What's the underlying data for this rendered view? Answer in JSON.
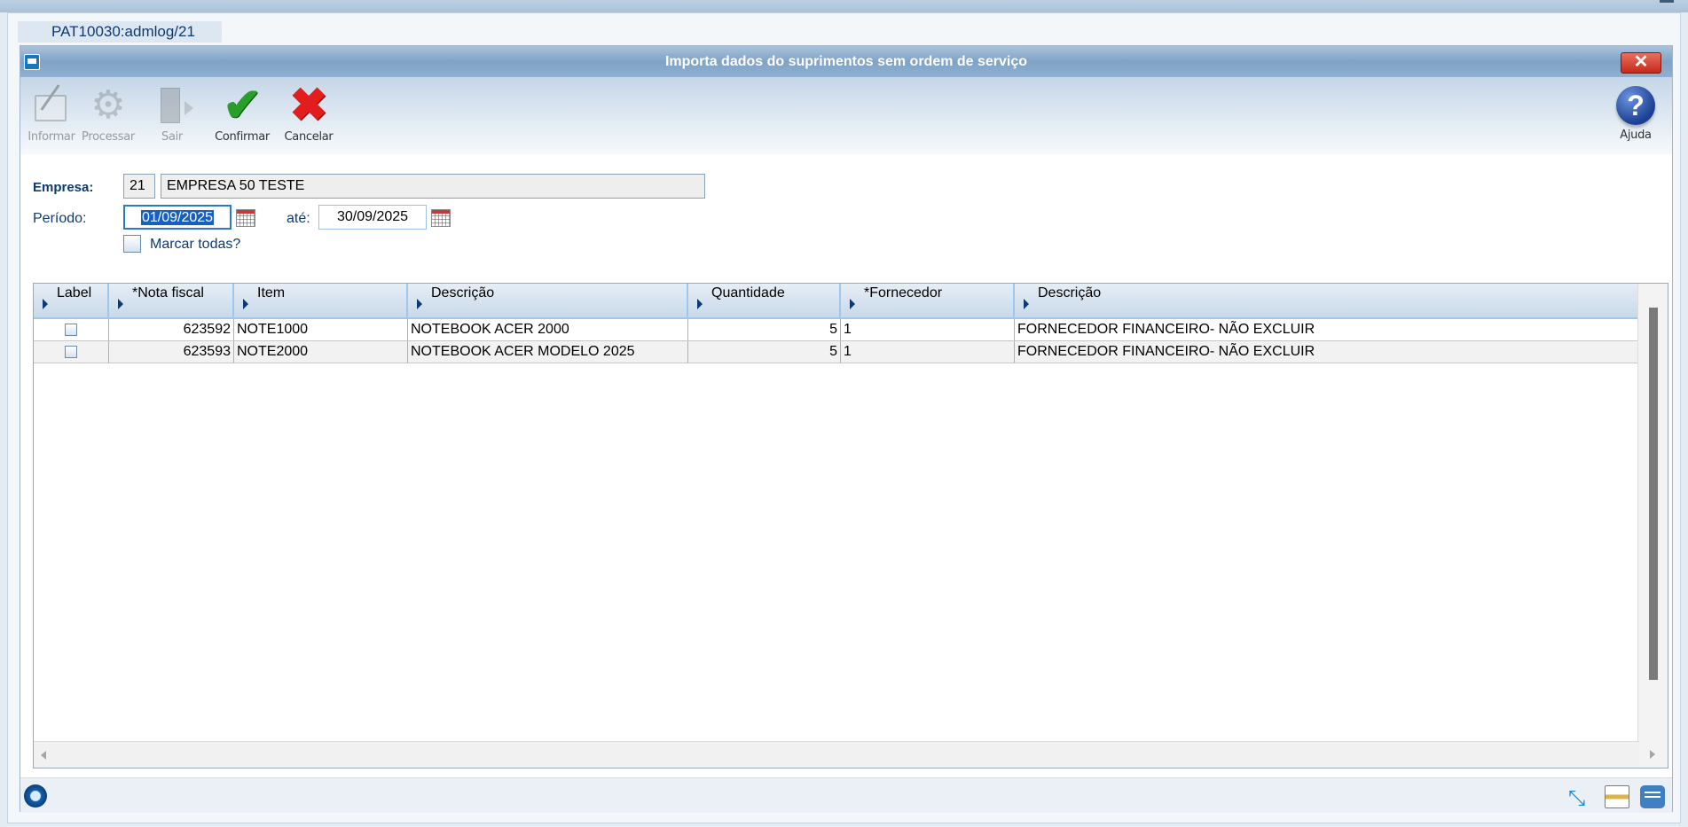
{
  "tab": {
    "label": "PAT10030:admlog/21"
  },
  "window": {
    "title": "Importa dados do suprimentos sem ordem de serviço",
    "close_label": "✕"
  },
  "toolbar": {
    "informar": "Informar",
    "processar": "Processar",
    "sair": "Sair",
    "confirmar": "Confirmar",
    "cancelar": "Cancelar",
    "ajuda": "Ajuda",
    "help_glyph": "?"
  },
  "form": {
    "empresa_label": "Empresa:",
    "empresa_code": "21",
    "empresa_name": "EMPRESA 50 TESTE",
    "periodo_label": "Período:",
    "date_from": "01/09/2025",
    "ate_label": "até:",
    "date_to": "30/09/2025",
    "marcar_label": "Marcar todas?"
  },
  "grid": {
    "columns": [
      "Label",
      "*Nota fiscal",
      "Item",
      "Descrição",
      "Quantidade",
      "*Fornecedor",
      "Descrição"
    ],
    "rows": [
      {
        "checked": false,
        "nota": "623592",
        "item": "NOTE1000",
        "descricao": "NOTEBOOK ACER 2000",
        "quantidade": "5",
        "fornecedor": "1",
        "desc_fornecedor": "FORNECEDOR FINANCEIRO- NÃO EXCLUIR"
      },
      {
        "checked": false,
        "nota": "623593",
        "item": "NOTE2000",
        "descricao": "NOTEBOOK ACER MODELO 2025",
        "quantidade": "5",
        "fornecedor": "1",
        "desc_fornecedor": "FORNECEDOR FINANCEIRO- NÃO EXCLUIR"
      }
    ]
  },
  "colors": {
    "title_text": "#ffffff",
    "label_blue": "#0d3a73",
    "header_border": "#9ec7ee"
  },
  "icons": {
    "toolbar": [
      "pen-icon",
      "gear-icon",
      "door-icon",
      "check-icon",
      "x-icon",
      "help-icon"
    ],
    "statusbar": [
      "logo-icon",
      "resize-icon",
      "print-icon",
      "chat-icon"
    ]
  }
}
